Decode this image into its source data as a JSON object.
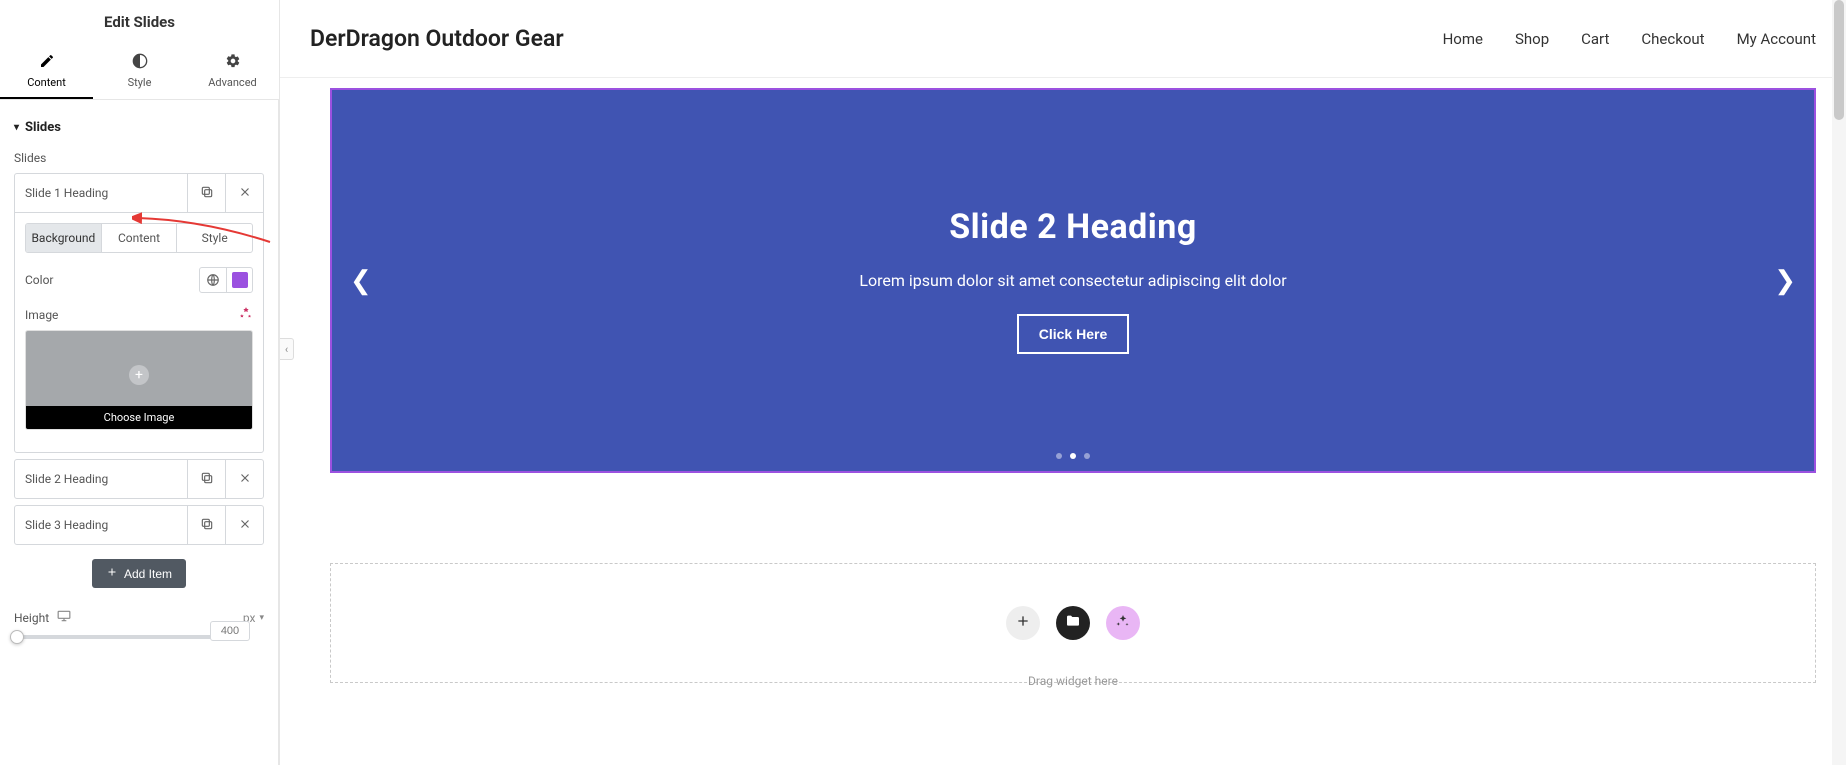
{
  "panel": {
    "title": "Edit Slides",
    "tabs": {
      "content": "Content",
      "style": "Style",
      "advanced": "Advanced"
    },
    "section_title": "Slides",
    "slides_label": "Slides",
    "add_item": "Add Item",
    "height_label": "Height",
    "height_unit": "px",
    "height_value": "400",
    "slide_editor": {
      "inner_tabs": {
        "background": "Background",
        "content": "Content",
        "style": "Style"
      },
      "color_label": "Color",
      "image_label": "Image",
      "choose_image": "Choose Image",
      "color_value": "#9b51e0"
    },
    "items": [
      {
        "label": "Slide 1 Heading"
      },
      {
        "label": "Slide 2 Heading"
      },
      {
        "label": "Slide 3 Heading"
      }
    ]
  },
  "site": {
    "brand": "DerDragon Outdoor Gear",
    "nav": {
      "home": "Home",
      "shop": "Shop",
      "cart": "Cart",
      "checkout": "Checkout",
      "account": "My Account"
    }
  },
  "slider": {
    "heading": "Slide 2 Heading",
    "subheading": "Lorem ipsum dolor sit amet consectetur adipiscing elit dolor",
    "cta": "Click Here"
  },
  "drop": {
    "hint": "Drag widget here"
  }
}
